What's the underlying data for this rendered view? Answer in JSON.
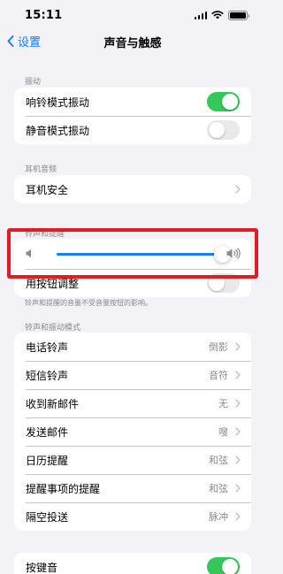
{
  "status_bar": {
    "time": "15:11"
  },
  "nav": {
    "back_label": "设置",
    "title": "声音与触感"
  },
  "vibration": {
    "header": "振动",
    "rows": [
      {
        "label": "响铃模式振动",
        "enabled": true
      },
      {
        "label": "静音模式振动",
        "enabled": false
      }
    ]
  },
  "headphone": {
    "header": "耳机音频",
    "rows": [
      {
        "label": "耳机安全"
      }
    ]
  },
  "ringer": {
    "header": "铃声和提醒",
    "volume_level": 0.96,
    "change_with_buttons": {
      "label": "用按钮调整",
      "enabled": false
    },
    "note": "铃声和提醒的音量不受音量按钮的影响。"
  },
  "patterns": {
    "header": "铃声和振动模式",
    "rows": [
      {
        "label": "电话铃声",
        "value": "倒影"
      },
      {
        "label": "短信铃声",
        "value": "音符"
      },
      {
        "label": "收到新邮件",
        "value": "无"
      },
      {
        "label": "发送邮件",
        "value": "嗖"
      },
      {
        "label": "日历提醒",
        "value": "和弦"
      },
      {
        "label": "提醒事项的提醒",
        "value": "和弦"
      },
      {
        "label": "隔空投送",
        "value": "脉冲"
      }
    ]
  },
  "keyboard": {
    "rows": [
      {
        "label": "按键音",
        "enabled": true
      }
    ]
  },
  "colors": {
    "accent": "#0a7aff",
    "switch_on": "#34c759",
    "slider_fill": "#1d7cf2",
    "highlight": "#e11d24"
  }
}
